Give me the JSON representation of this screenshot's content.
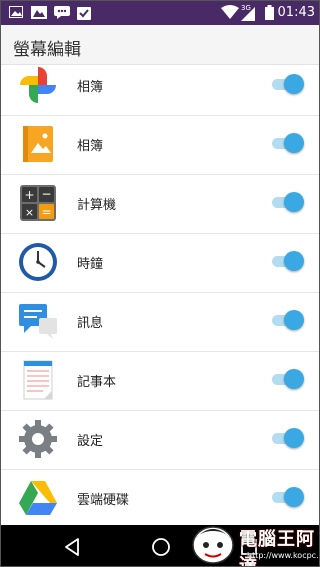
{
  "status_bar": {
    "time": "01:43",
    "network_label": "3G",
    "icons": [
      "image-icon",
      "gallery-icon",
      "chat-icon",
      "clipboard-check-icon",
      "wifi-icon",
      "signal-icon",
      "battery-icon"
    ]
  },
  "header": {
    "title": "螢幕編輯"
  },
  "items": [
    {
      "label": "相簿",
      "icon": "google-photos-icon",
      "enabled": true
    },
    {
      "label": "相簿",
      "icon": "album-icon",
      "enabled": true
    },
    {
      "label": "計算機",
      "icon": "calculator-icon",
      "enabled": true
    },
    {
      "label": "時鐘",
      "icon": "clock-icon",
      "enabled": true
    },
    {
      "label": "訊息",
      "icon": "messages-icon",
      "enabled": true
    },
    {
      "label": "記事本",
      "icon": "notepad-icon",
      "enabled": true
    },
    {
      "label": "設定",
      "icon": "settings-gear-icon",
      "enabled": true
    },
    {
      "label": "雲端硬碟",
      "icon": "google-drive-icon",
      "enabled": true
    }
  ],
  "nav_bar": {
    "buttons": [
      "back-icon",
      "home-icon",
      "recents-icon"
    ]
  },
  "watermark": {
    "text": "電腦王阿達",
    "url": "http://www.kocpc.com.tw"
  },
  "colors": {
    "status_bar": "#4a2a66",
    "switch_thumb": "#3aa8e2",
    "switch_track": "#b3dcf1",
    "header_bg": "#f5f5f5"
  }
}
